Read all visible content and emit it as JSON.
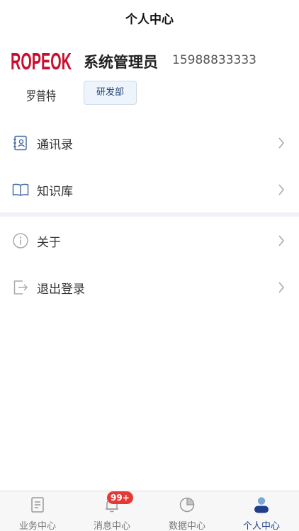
{
  "header": {
    "title": "个人中心"
  },
  "profile": {
    "logo_text": "ROPEOK",
    "logo_subtext": "罗普特",
    "name": "系统管理员",
    "phone": "15988833333",
    "department": "研发部"
  },
  "menu": [
    {
      "label": "通讯录",
      "icon": "contacts-icon"
    },
    {
      "label": "知识库",
      "icon": "book-icon"
    },
    {
      "label": "关于",
      "icon": "info-icon"
    },
    {
      "label": "退出登录",
      "icon": "logout-icon"
    }
  ],
  "tabbar": {
    "tabs": [
      {
        "label": "业务中心",
        "icon": "document-icon",
        "active": false
      },
      {
        "label": "消息中心",
        "icon": "bell-icon",
        "active": false,
        "badge": "99+"
      },
      {
        "label": "数据中心",
        "icon": "pie-chart-icon",
        "active": false
      },
      {
        "label": "个人中心",
        "icon": "user-icon",
        "active": true
      }
    ]
  },
  "colors": {
    "accent": "#1f3f8c",
    "logo_red": "#c8102e",
    "badge_red": "#e53935",
    "divider": "#f1f2f8"
  }
}
